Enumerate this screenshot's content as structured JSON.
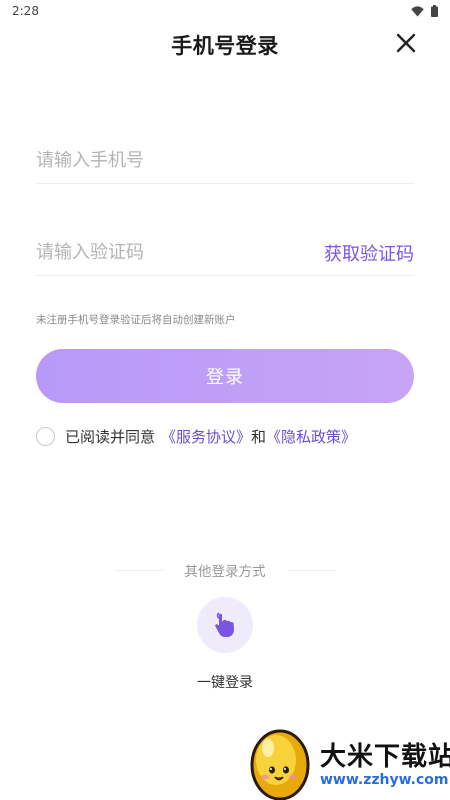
{
  "status_bar": {
    "time": "2:28",
    "icons": [
      "wifi-icon",
      "battery-icon"
    ]
  },
  "header": {
    "title": "手机号登录",
    "close_icon": "close-icon"
  },
  "form": {
    "phone_placeholder": "请输入手机号",
    "code_placeholder": "请输入验证码",
    "get_code_label": "获取验证码",
    "hint": "未注册手机号登录验证后将自动创建新账户",
    "login_label": "登录"
  },
  "agreement": {
    "prefix": "已阅读并同意",
    "service_link": "《服务协议》",
    "and": "和",
    "privacy_link": "《隐私政策》"
  },
  "other_login": {
    "title": "其他登录方式",
    "onekey_label": "一键登录",
    "onekey_icon": "tap-icon"
  },
  "watermark": {
    "name": "大米下载站",
    "url": "www.zzhyw.com"
  },
  "colors": {
    "accent": "#7a56e0",
    "button": "#b799f9",
    "link": "#6a4fd0",
    "watermark_url": "#2a6de0"
  }
}
